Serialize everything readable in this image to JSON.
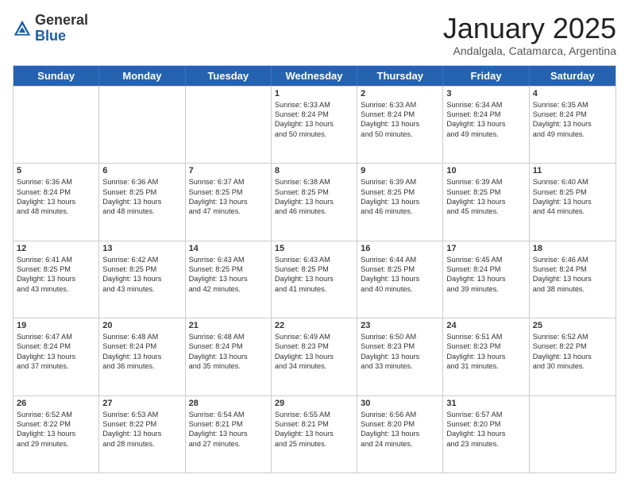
{
  "logo": {
    "general": "General",
    "blue": "Blue"
  },
  "header": {
    "month": "January 2025",
    "location": "Andalgala, Catamarca, Argentina"
  },
  "days": [
    "Sunday",
    "Monday",
    "Tuesday",
    "Wednesday",
    "Thursday",
    "Friday",
    "Saturday"
  ],
  "weeks": [
    [
      {
        "day": "",
        "text": ""
      },
      {
        "day": "",
        "text": ""
      },
      {
        "day": "",
        "text": ""
      },
      {
        "day": "1",
        "text": "Sunrise: 6:33 AM\nSunset: 8:24 PM\nDaylight: 13 hours\nand 50 minutes."
      },
      {
        "day": "2",
        "text": "Sunrise: 6:33 AM\nSunset: 8:24 PM\nDaylight: 13 hours\nand 50 minutes."
      },
      {
        "day": "3",
        "text": "Sunrise: 6:34 AM\nSunset: 8:24 PM\nDaylight: 13 hours\nand 49 minutes."
      },
      {
        "day": "4",
        "text": "Sunrise: 6:35 AM\nSunset: 8:24 PM\nDaylight: 13 hours\nand 49 minutes."
      }
    ],
    [
      {
        "day": "5",
        "text": "Sunrise: 6:36 AM\nSunset: 8:24 PM\nDaylight: 13 hours\nand 48 minutes."
      },
      {
        "day": "6",
        "text": "Sunrise: 6:36 AM\nSunset: 8:25 PM\nDaylight: 13 hours\nand 48 minutes."
      },
      {
        "day": "7",
        "text": "Sunrise: 6:37 AM\nSunset: 8:25 PM\nDaylight: 13 hours\nand 47 minutes."
      },
      {
        "day": "8",
        "text": "Sunrise: 6:38 AM\nSunset: 8:25 PM\nDaylight: 13 hours\nand 46 minutes."
      },
      {
        "day": "9",
        "text": "Sunrise: 6:39 AM\nSunset: 8:25 PM\nDaylight: 13 hours\nand 46 minutes."
      },
      {
        "day": "10",
        "text": "Sunrise: 6:39 AM\nSunset: 8:25 PM\nDaylight: 13 hours\nand 45 minutes."
      },
      {
        "day": "11",
        "text": "Sunrise: 6:40 AM\nSunset: 8:25 PM\nDaylight: 13 hours\nand 44 minutes."
      }
    ],
    [
      {
        "day": "12",
        "text": "Sunrise: 6:41 AM\nSunset: 8:25 PM\nDaylight: 13 hours\nand 43 minutes."
      },
      {
        "day": "13",
        "text": "Sunrise: 6:42 AM\nSunset: 8:25 PM\nDaylight: 13 hours\nand 43 minutes."
      },
      {
        "day": "14",
        "text": "Sunrise: 6:43 AM\nSunset: 8:25 PM\nDaylight: 13 hours\nand 42 minutes."
      },
      {
        "day": "15",
        "text": "Sunrise: 6:43 AM\nSunset: 8:25 PM\nDaylight: 13 hours\nand 41 minutes."
      },
      {
        "day": "16",
        "text": "Sunrise: 6:44 AM\nSunset: 8:25 PM\nDaylight: 13 hours\nand 40 minutes."
      },
      {
        "day": "17",
        "text": "Sunrise: 6:45 AM\nSunset: 8:24 PM\nDaylight: 13 hours\nand 39 minutes."
      },
      {
        "day": "18",
        "text": "Sunrise: 6:46 AM\nSunset: 8:24 PM\nDaylight: 13 hours\nand 38 minutes."
      }
    ],
    [
      {
        "day": "19",
        "text": "Sunrise: 6:47 AM\nSunset: 8:24 PM\nDaylight: 13 hours\nand 37 minutes."
      },
      {
        "day": "20",
        "text": "Sunrise: 6:48 AM\nSunset: 8:24 PM\nDaylight: 13 hours\nand 36 minutes."
      },
      {
        "day": "21",
        "text": "Sunrise: 6:48 AM\nSunset: 8:24 PM\nDaylight: 13 hours\nand 35 minutes."
      },
      {
        "day": "22",
        "text": "Sunrise: 6:49 AM\nSunset: 8:23 PM\nDaylight: 13 hours\nand 34 minutes."
      },
      {
        "day": "23",
        "text": "Sunrise: 6:50 AM\nSunset: 8:23 PM\nDaylight: 13 hours\nand 33 minutes."
      },
      {
        "day": "24",
        "text": "Sunrise: 6:51 AM\nSunset: 8:23 PM\nDaylight: 13 hours\nand 31 minutes."
      },
      {
        "day": "25",
        "text": "Sunrise: 6:52 AM\nSunset: 8:22 PM\nDaylight: 13 hours\nand 30 minutes."
      }
    ],
    [
      {
        "day": "26",
        "text": "Sunrise: 6:52 AM\nSunset: 8:22 PM\nDaylight: 13 hours\nand 29 minutes."
      },
      {
        "day": "27",
        "text": "Sunrise: 6:53 AM\nSunset: 8:22 PM\nDaylight: 13 hours\nand 28 minutes."
      },
      {
        "day": "28",
        "text": "Sunrise: 6:54 AM\nSunset: 8:21 PM\nDaylight: 13 hours\nand 27 minutes."
      },
      {
        "day": "29",
        "text": "Sunrise: 6:55 AM\nSunset: 8:21 PM\nDaylight: 13 hours\nand 25 minutes."
      },
      {
        "day": "30",
        "text": "Sunrise: 6:56 AM\nSunset: 8:20 PM\nDaylight: 13 hours\nand 24 minutes."
      },
      {
        "day": "31",
        "text": "Sunrise: 6:57 AM\nSunset: 8:20 PM\nDaylight: 13 hours\nand 23 minutes."
      },
      {
        "day": "",
        "text": ""
      }
    ]
  ]
}
